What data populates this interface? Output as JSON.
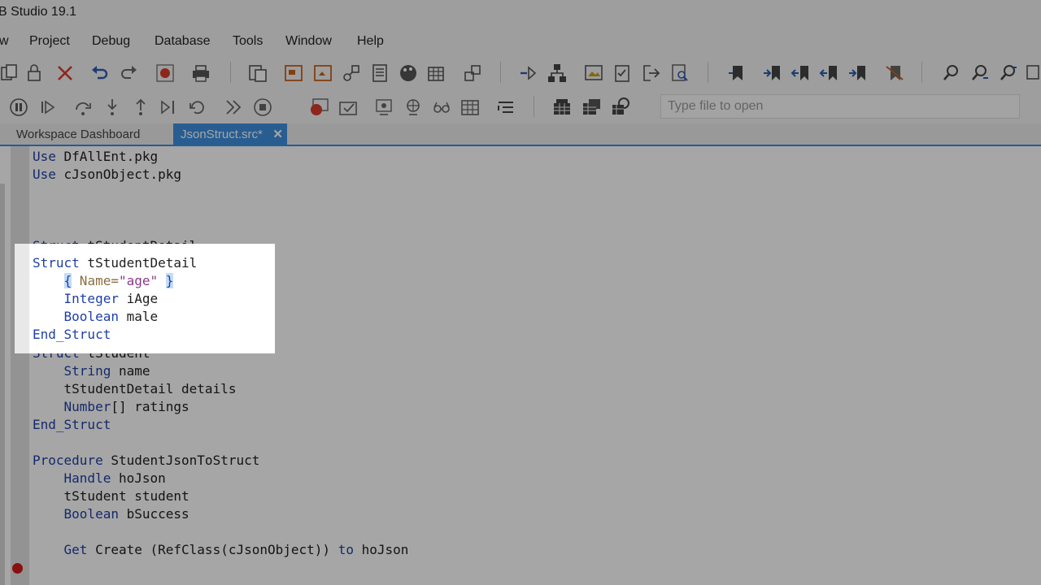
{
  "window": {
    "title": "B Studio 19.1"
  },
  "menu": [
    "w",
    "Project",
    "Debug",
    "Database",
    "Tools",
    "Window",
    "Help"
  ],
  "toolbar": {
    "row1_icons": [
      "copy-icon",
      "lock-icon",
      "delete-icon",
      "undo-icon",
      "redo-icon",
      "record-icon",
      "print-icon",
      "paste-icon",
      "open-report-icon",
      "new-view-icon",
      "view-tools-icon",
      "list-icon",
      "palette-icon",
      "grid-icon",
      "dependency-icon",
      "link-icon",
      "network-icon",
      "image-icon",
      "checklist-icon",
      "logout-icon",
      "zoom-page-icon",
      "bookmark-icon",
      "bookmark-next-icon",
      "bookmark-prev-icon",
      "bookmark-first-icon",
      "bookmark-last-icon",
      "bookmark-clear-icon",
      "find-icon",
      "find-next-icon",
      "find-prev-icon",
      "replace-icon"
    ],
    "row2_icons": [
      "pause-icon",
      "play-icon",
      "step-over-icon",
      "step-into-icon",
      "step-out-icon",
      "run-to-cursor-icon",
      "restart-icon",
      "stop-icon",
      "breakpoint-icon",
      "stack-icon",
      "watch-icon",
      "locals-icon",
      "glasses-icon",
      "table-icon",
      "list-indent-icon",
      "database-icon",
      "table-grid-icon",
      "database-explorer-icon"
    ],
    "search_placeholder": "Type file to open"
  },
  "tabs": [
    {
      "label": "Workspace Dashboard",
      "active": false
    },
    {
      "label": "JsonStruct.src*",
      "active": true
    }
  ],
  "code_lines": [
    {
      "segments": [
        {
          "t": "Use",
          "c": "kw"
        },
        {
          "t": " DfAllEnt.pkg",
          "c": ""
        }
      ]
    },
    {
      "segments": [
        {
          "t": "Use",
          "c": "kw"
        },
        {
          "t": " cJsonObject.pkg",
          "c": ""
        }
      ]
    },
    {
      "segments": []
    },
    {
      "segments": []
    },
    {
      "segments": []
    },
    {
      "segments": [
        {
          "t": "Struct",
          "c": "kw"
        },
        {
          "t": " tStudentDetail",
          "c": ""
        }
      ]
    },
    {
      "segments": [
        {
          "t": "    ",
          "c": ""
        },
        {
          "t": "{",
          "c": "brace"
        },
        {
          "t": " Name=",
          "c": "attr"
        },
        {
          "t": "\"age\"",
          "c": "str"
        },
        {
          "t": " ",
          "c": ""
        },
        {
          "t": "}",
          "c": "brace"
        }
      ]
    },
    {
      "segments": [
        {
          "t": "    ",
          "c": ""
        },
        {
          "t": "Integer",
          "c": "kw"
        },
        {
          "t": " iAge",
          "c": ""
        }
      ]
    },
    {
      "segments": [
        {
          "t": "    ",
          "c": ""
        },
        {
          "t": "Boolean",
          "c": "kw"
        },
        {
          "t": " male",
          "c": ""
        }
      ]
    },
    {
      "segments": [
        {
          "t": "End_Struct",
          "c": "kw"
        }
      ]
    },
    {
      "segments": []
    },
    {
      "segments": [
        {
          "t": "Struct",
          "c": "kw"
        },
        {
          "t": " tStudent",
          "c": ""
        }
      ]
    },
    {
      "segments": [
        {
          "t": "    ",
          "c": ""
        },
        {
          "t": "String",
          "c": "kw"
        },
        {
          "t": " name",
          "c": ""
        }
      ]
    },
    {
      "segments": [
        {
          "t": "    tStudentDetail details",
          "c": ""
        }
      ]
    },
    {
      "segments": [
        {
          "t": "    ",
          "c": ""
        },
        {
          "t": "Number",
          "c": "kw"
        },
        {
          "t": "[] ratings",
          "c": ""
        }
      ]
    },
    {
      "segments": [
        {
          "t": "End_Struct",
          "c": "kw"
        }
      ]
    },
    {
      "segments": []
    },
    {
      "segments": [
        {
          "t": "Procedure",
          "c": "kw"
        },
        {
          "t": " StudentJsonToStruct",
          "c": ""
        }
      ]
    },
    {
      "segments": [
        {
          "t": "    ",
          "c": ""
        },
        {
          "t": "Handle",
          "c": "kw"
        },
        {
          "t": " hoJson",
          "c": ""
        }
      ]
    },
    {
      "segments": [
        {
          "t": "    tStudent student",
          "c": ""
        }
      ]
    },
    {
      "segments": [
        {
          "t": "    ",
          "c": ""
        },
        {
          "t": "Boolean",
          "c": "kw"
        },
        {
          "t": " bSuccess",
          "c": ""
        }
      ]
    },
    {
      "segments": []
    },
    {
      "segments": [
        {
          "t": "    ",
          "c": ""
        },
        {
          "t": "Get",
          "c": "kw"
        },
        {
          "t": " Create (RefClass(cJsonObject)) ",
          "c": ""
        },
        {
          "t": "to",
          "c": "kw"
        },
        {
          "t": " hoJson",
          "c": ""
        }
      ]
    }
  ],
  "highlight_lines": [
    5,
    6,
    7,
    8,
    9
  ],
  "breakpoint_line": 22,
  "colors": {
    "accent": "#3e8fe0",
    "keyword": "#1f3fa6",
    "breakpoint": "#d11a1a"
  }
}
